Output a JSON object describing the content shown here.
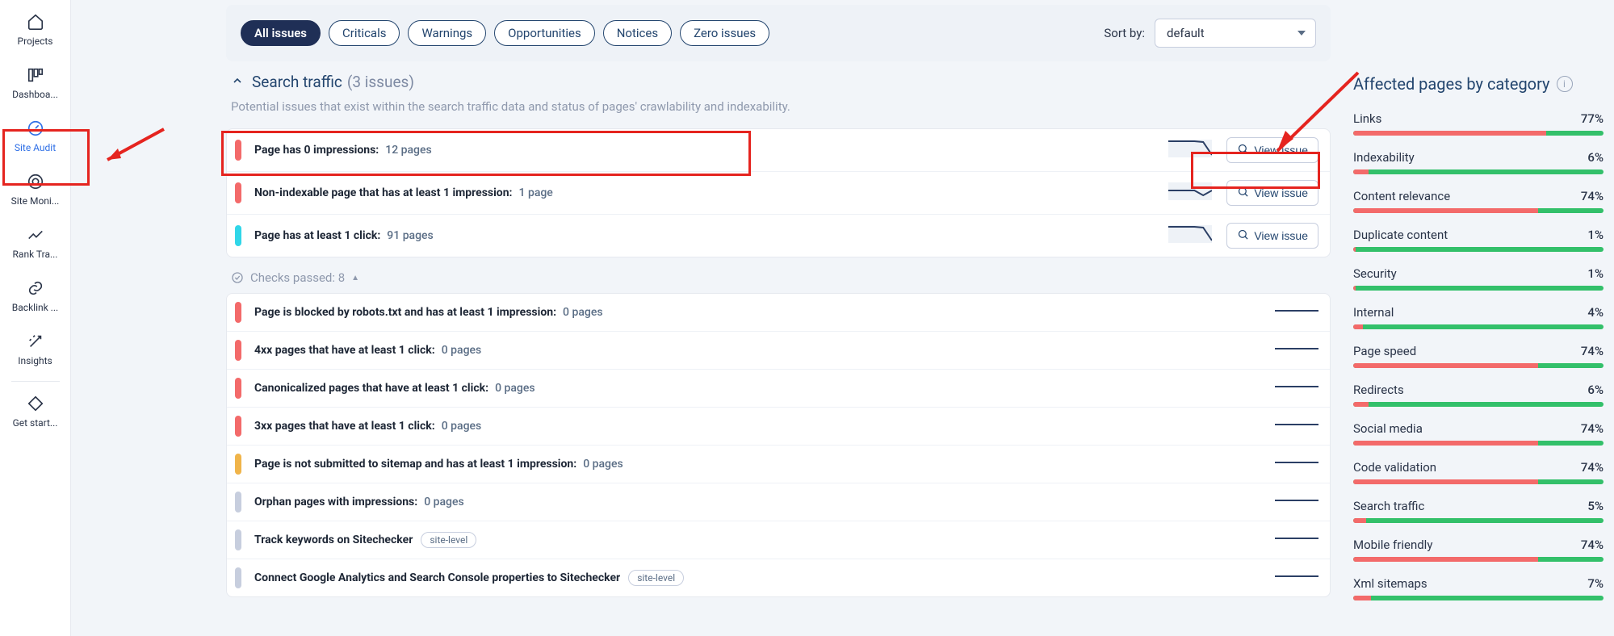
{
  "sidebar": {
    "items": [
      {
        "label": "Projects",
        "icon": "home-icon"
      },
      {
        "label": "Dashboa...",
        "icon": "dashboard-icon"
      },
      {
        "label": "Site Audit",
        "icon": "speed-icon",
        "selected": true
      },
      {
        "label": "Site Moni...",
        "icon": "monitor-icon"
      },
      {
        "label": "Rank Tra...",
        "icon": "trend-icon"
      },
      {
        "label": "Backlink ...",
        "icon": "link-icon"
      },
      {
        "label": "Insights",
        "icon": "wand-icon"
      },
      {
        "label": "Get start...",
        "icon": "diamond-icon"
      }
    ]
  },
  "filters": {
    "pills": [
      "All issues",
      "Criticals",
      "Warnings",
      "Opportunities",
      "Notices",
      "Zero issues"
    ],
    "active": 0,
    "sort_label": "Sort by:",
    "sort_value": "default"
  },
  "section": {
    "title": "Search traffic",
    "count_text": "(3 issues)",
    "description": "Potential issues that exist within the search traffic data and status of pages' crawlability and indexability."
  },
  "view_issue_label": "View issue",
  "active_issues": [
    {
      "sev": "red",
      "title": "Page has 0 impressions:",
      "pages": "12 pages",
      "spark": [
        20,
        20,
        20,
        20,
        19,
        3
      ],
      "view": true
    },
    {
      "sev": "red",
      "title": "Non-indexable page that has at least 1 impression:",
      "pages": "1 page",
      "spark": [
        12,
        12,
        12,
        12,
        6,
        12
      ],
      "view": true
    },
    {
      "sev": "cyan",
      "title": "Page has at least 1 click:",
      "pages": "91 pages",
      "spark": [
        20,
        20,
        20,
        20,
        19,
        3
      ],
      "view": true
    }
  ],
  "checks_passed_label": "Checks passed: 8",
  "zero_issues": [
    {
      "sev": "red",
      "title": "Page is blocked by robots.txt and has at least 1 impression:",
      "pages": "0 pages"
    },
    {
      "sev": "red",
      "title": "4xx pages that have at least 1 click:",
      "pages": "0 pages"
    },
    {
      "sev": "red",
      "title": "Canonicalized pages that have at least 1 click:",
      "pages": "0 pages"
    },
    {
      "sev": "red",
      "title": "3xx pages that have at least 1 click:",
      "pages": "0 pages"
    },
    {
      "sev": "orange",
      "title": "Page is not submitted to sitemap and has at least 1 impression:",
      "pages": "0 pages"
    },
    {
      "sev": "gray",
      "title": "Orphan pages with impressions:",
      "pages": "0 pages"
    },
    {
      "sev": "gray",
      "title": "Track keywords on Sitechecker",
      "pages": "",
      "tag": "site-level"
    },
    {
      "sev": "gray",
      "title": "Connect Google Analytics and Search Console properties to Sitechecker",
      "pages": "",
      "tag": "site-level"
    }
  ],
  "panel": {
    "title": "Affected pages by category",
    "categories": [
      {
        "name": "Links",
        "pct": 77
      },
      {
        "name": "Indexability",
        "pct": 6
      },
      {
        "name": "Content relevance",
        "pct": 74
      },
      {
        "name": "Duplicate content",
        "pct": 1
      },
      {
        "name": "Security",
        "pct": 1
      },
      {
        "name": "Internal",
        "pct": 4
      },
      {
        "name": "Page speed",
        "pct": 74
      },
      {
        "name": "Redirects",
        "pct": 6
      },
      {
        "name": "Social media",
        "pct": 74
      },
      {
        "name": "Code validation",
        "pct": 74
      },
      {
        "name": "Search traffic",
        "pct": 5
      },
      {
        "name": "Mobile friendly",
        "pct": 74
      },
      {
        "name": "Xml sitemaps",
        "pct": 7
      }
    ]
  }
}
